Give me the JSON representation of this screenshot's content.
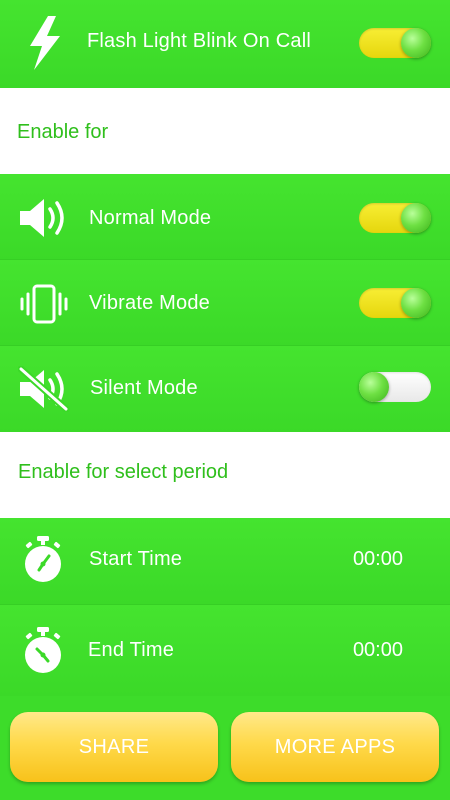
{
  "header": {
    "title": "Flash Light Blink On Call",
    "icon": "lightning-bolt-icon",
    "toggle_on": true
  },
  "sections": {
    "enable_for": "Enable for",
    "enable_period": "Enable for select period"
  },
  "modes": [
    {
      "label": "Normal Mode",
      "icon": "speaker-icon",
      "toggle_on": true
    },
    {
      "label": "Vibrate Mode",
      "icon": "vibrate-icon",
      "toggle_on": true
    },
    {
      "label": "Silent Mode",
      "icon": "speaker-muted-icon",
      "toggle_on": false
    }
  ],
  "times": [
    {
      "label": "Start Time",
      "value": "00:00",
      "icon": "stopwatch-icon"
    },
    {
      "label": "End Time",
      "value": "00:00",
      "icon": "stopwatch-icon"
    }
  ],
  "buttons": {
    "share": "SHARE",
    "more_apps": "MORE APPS"
  },
  "colors": {
    "green": "#3ddc2a",
    "section_text": "#2fbf1c",
    "toggle_on": "#f2e424",
    "button": "#ffd94a"
  }
}
